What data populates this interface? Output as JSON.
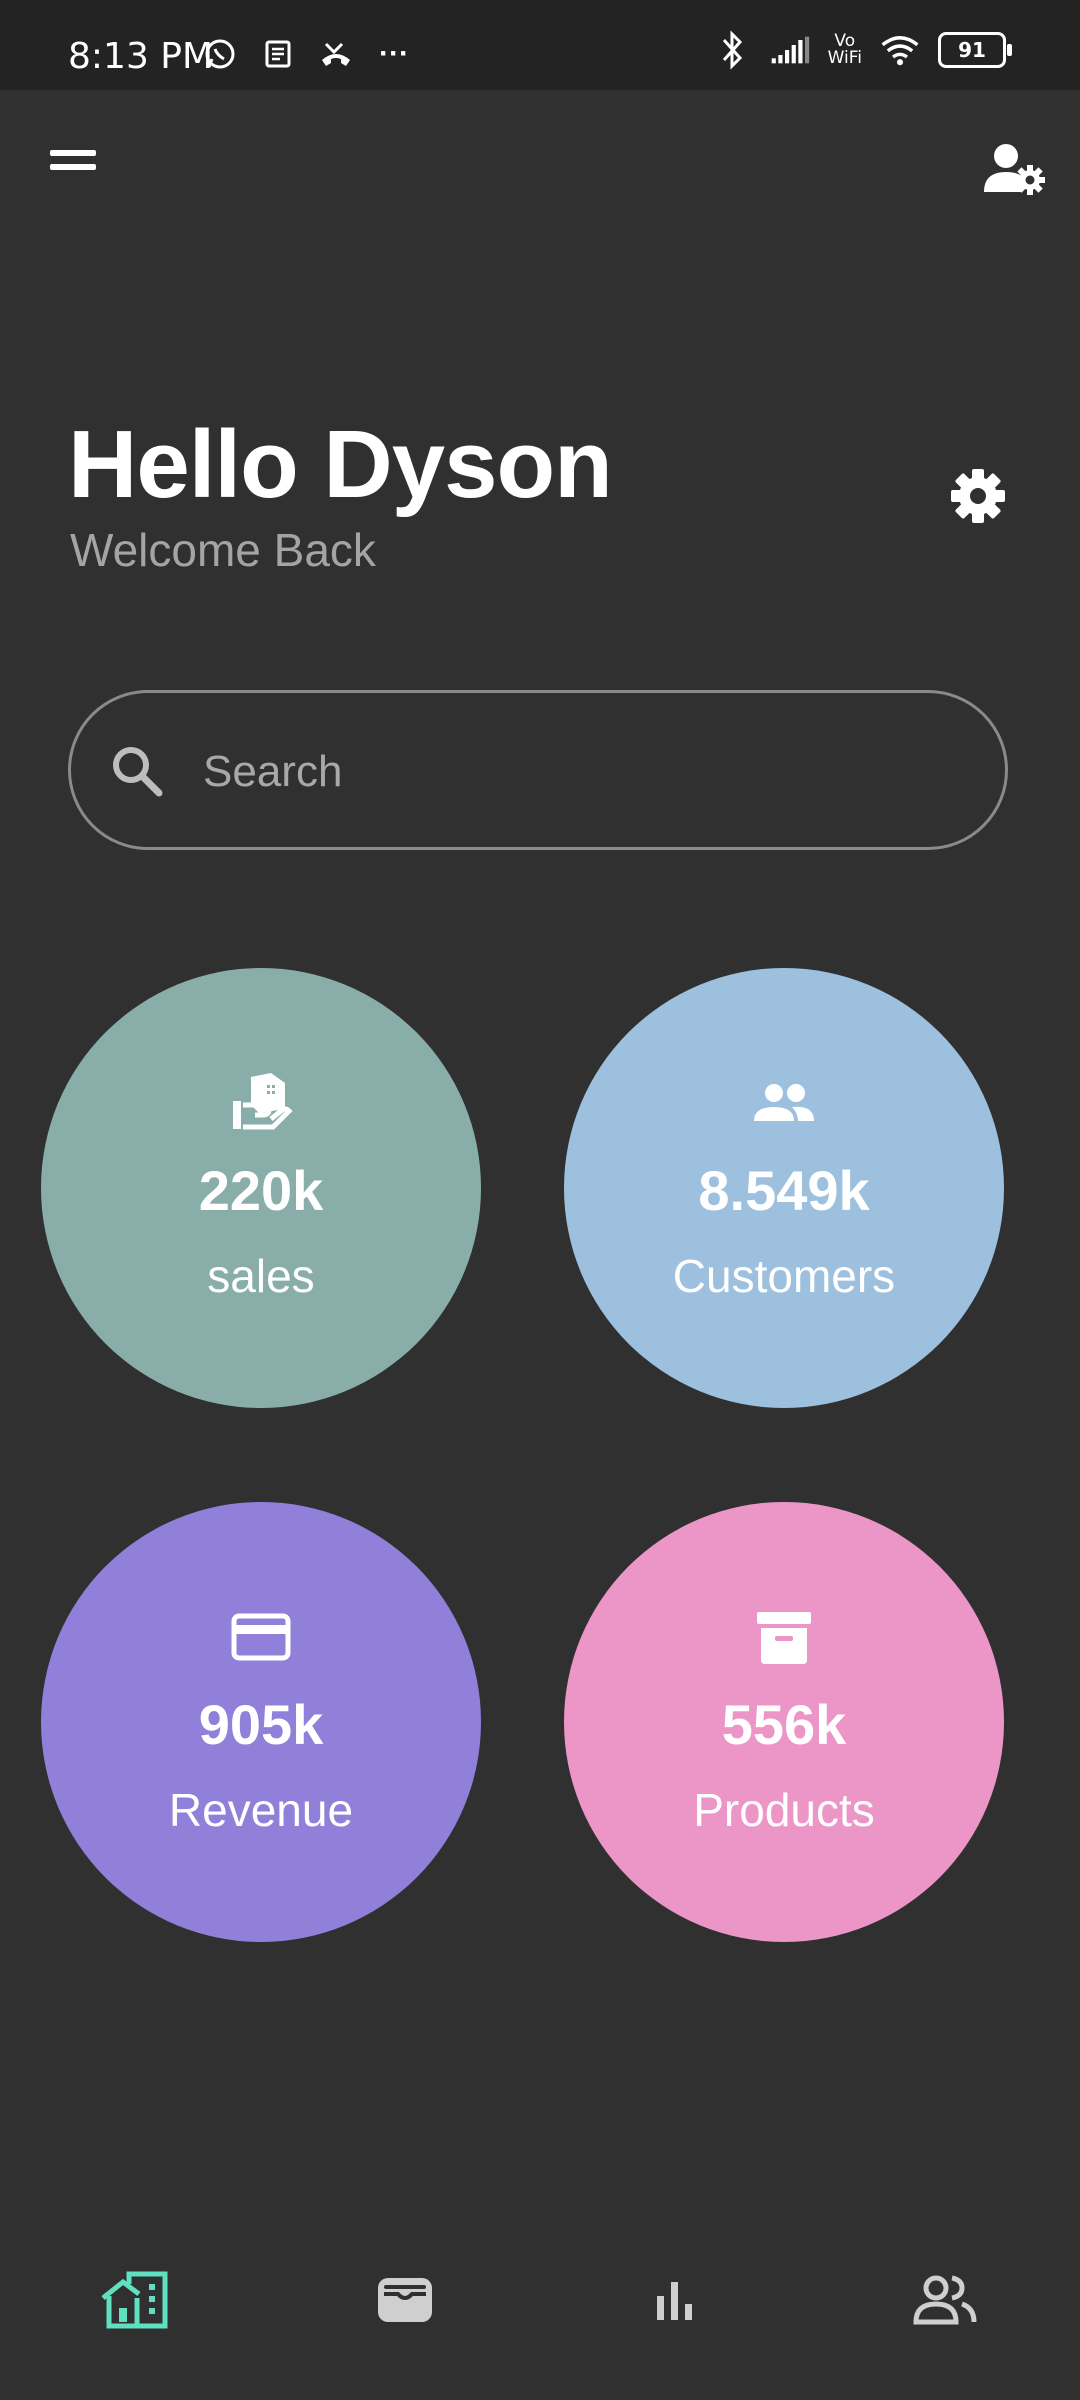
{
  "status_bar": {
    "time": "8:13 PM",
    "battery": "91",
    "vowifi_top": "Vo",
    "vowifi_bottom": "WiFi",
    "more": "···"
  },
  "header": {
    "greeting": "Hello Dyson",
    "subtitle": "Welcome Back"
  },
  "search": {
    "placeholder": "Search"
  },
  "stats": [
    {
      "icon": "store-icon",
      "value": "220k",
      "label": "sales",
      "color": "#89aeaa"
    },
    {
      "icon": "group-icon",
      "value": "8.549k",
      "label": "Customers",
      "color": "#9cc0dd"
    },
    {
      "icon": "credit-card-icon",
      "value": "905k",
      "label": "Revenue",
      "color": "#9080d9"
    },
    {
      "icon": "archive-box-icon",
      "value": "556k",
      "label": "Products",
      "color": "#eb96c7"
    }
  ],
  "bottom_nav": {
    "active": "home",
    "active_color": "#5fe0c0",
    "inactive_color": "#cfcfcf",
    "items": [
      "home-building-icon",
      "wallet-icon",
      "bar-chart-icon",
      "people-icon"
    ]
  }
}
